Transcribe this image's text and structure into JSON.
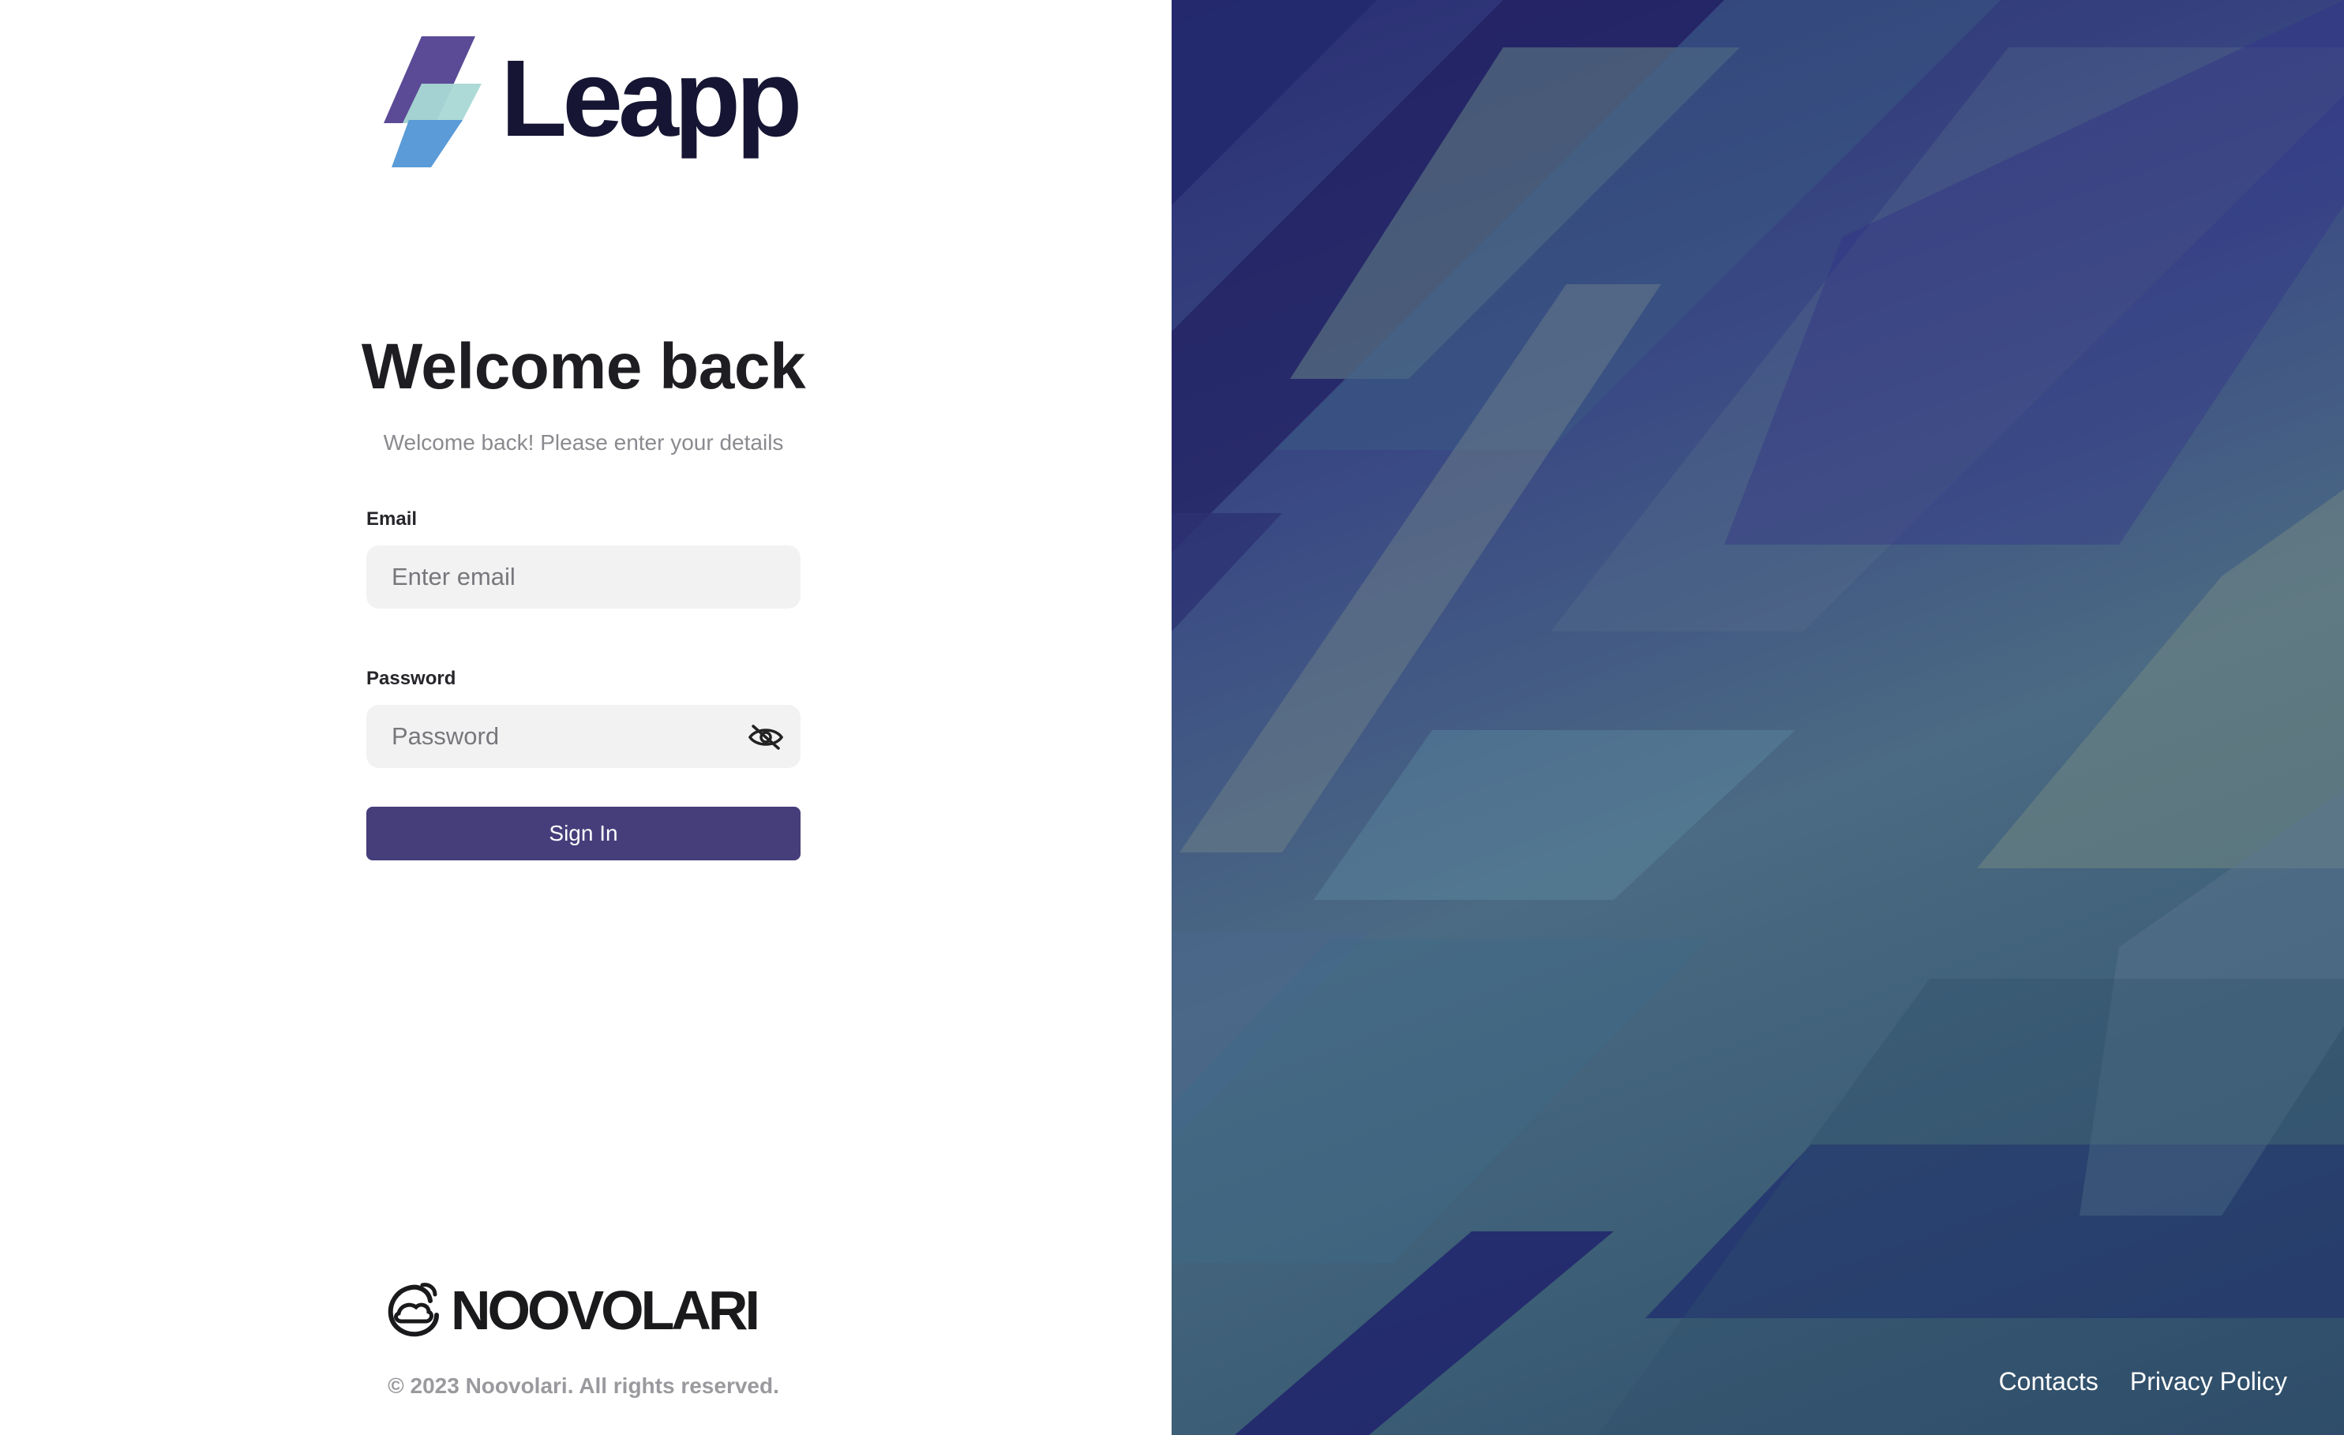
{
  "brand": {
    "name": "Leapp",
    "icon": "leapp-lightning-logo"
  },
  "form": {
    "title": "Welcome back",
    "subtitle": "Welcome back! Please enter your details",
    "email_label": "Email",
    "email_placeholder": "Enter email",
    "password_label": "Password",
    "password_placeholder": "Password",
    "password_toggle_icon": "eye-off-icon",
    "submit_label": "Sign In",
    "accent_color": "#463e7b"
  },
  "footer": {
    "company": "NOOVOLARI",
    "company_icon": "noovolari-cloud-logo",
    "copyright": "© 2023 Noovolari. All rights reserved."
  },
  "links": {
    "contacts": "Contacts",
    "privacy": "Privacy Policy"
  }
}
